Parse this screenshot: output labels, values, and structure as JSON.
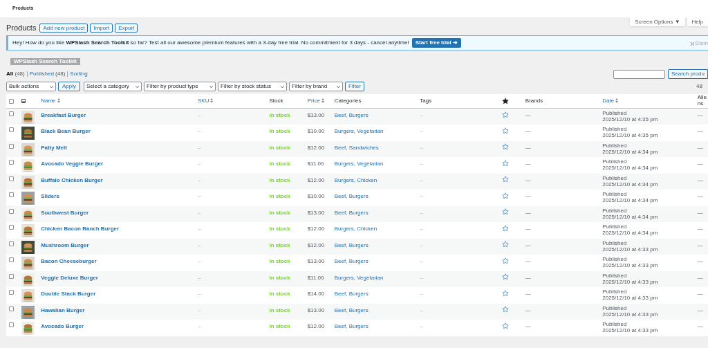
{
  "topbar": {
    "title": "Products"
  },
  "screen_tabs": [
    "Screen Options ▼",
    "Help"
  ],
  "heading": {
    "title": "Products",
    "buttons": [
      "Add new product",
      "Import",
      "Export"
    ]
  },
  "notice": {
    "text": "Hey! How do you like **WPSlash Search Toolkit** so far? Test all our awesome premium features with a 3-day free trial. No commitment for 3 days - cancel anytime!",
    "button": "Start free trial ➜",
    "dismiss": "Dism",
    "badge": "WPSlash Search Toolkit"
  },
  "views": [
    {
      "label": "All",
      "count": "(48)",
      "selected": true
    },
    {
      "label": "Published",
      "count": "(48)",
      "selected": false
    },
    {
      "label": "Sorting",
      "selected": false
    }
  ],
  "search": {
    "button": "Search produ"
  },
  "toolbar": {
    "selects": [
      "Bulk actions",
      "Select a category",
      "Filter by product type",
      "Filter by stock status",
      "Filter by brand"
    ],
    "apply": "Apply",
    "filter": "Filter",
    "count": "48"
  },
  "select_all": {
    "checked": false
  },
  "columns": [
    {
      "kind": "check"
    },
    {
      "kind": "thumb"
    },
    {
      "kind": "text",
      "label": "Name",
      "sortable": true
    },
    {
      "kind": "text",
      "label": "SKU",
      "sortable": true
    },
    {
      "kind": "text",
      "label": "Stock",
      "sortable": false
    },
    {
      "kind": "text",
      "label": "Price",
      "sortable": true
    },
    {
      "kind": "text",
      "label": "Categories",
      "sortable": false
    },
    {
      "kind": "text",
      "label": "Tags",
      "sortable": false
    },
    {
      "kind": "featured"
    },
    {
      "kind": "text",
      "label": "Brands",
      "sortable": false
    },
    {
      "kind": "text",
      "label": "Date",
      "sortable": true
    },
    {
      "kind": "text",
      "label": "Alle ns",
      "sortable": false
    }
  ],
  "rows": [
    {
      "checked": false,
      "name": "Breakfast Burger",
      "sku": "–",
      "stock": "In stock",
      "price": "$13.00",
      "categories": "Beef, Burgers",
      "tags": "–",
      "featured": false,
      "brands": "—",
      "status": "Published",
      "date": "2025/12/10 at 4:35 pm",
      "allergens": "—"
    },
    {
      "checked": false,
      "name": "Black Bean Burger",
      "sku": "–",
      "stock": "In stock",
      "price": "$10.00",
      "categories": "Burgers, Vegetarian",
      "tags": "–",
      "featured": false,
      "brands": "—",
      "status": "Published",
      "date": "2025/12/10 at 4:35 pm",
      "allergens": "—"
    },
    {
      "checked": false,
      "name": "Patty Melt",
      "sku": "–",
      "stock": "In stock",
      "price": "$12.00",
      "categories": "Beef, Sandwiches",
      "tags": "–",
      "featured": false,
      "brands": "—",
      "status": "Published",
      "date": "2025/12/10 at 4:34 pm",
      "allergens": "—"
    },
    {
      "checked": false,
      "name": "Avocado Veggie Burger",
      "sku": "–",
      "stock": "In stock",
      "price": "$11.00",
      "categories": "Burgers, Vegetarian",
      "tags": "–",
      "featured": false,
      "brands": "—",
      "status": "Published",
      "date": "2025/12/10 at 4:34 pm",
      "allergens": "—"
    },
    {
      "checked": false,
      "name": "Buffalo Chicken Burger",
      "sku": "–",
      "stock": "In stock",
      "price": "$12.00",
      "categories": "Burgers, Chicken",
      "tags": "–",
      "featured": false,
      "brands": "—",
      "status": "Published",
      "date": "2025/12/10 at 4:34 pm",
      "allergens": "—"
    },
    {
      "checked": false,
      "name": "Sliders",
      "sku": "–",
      "stock": "In stock",
      "price": "$10.00",
      "categories": "Beef, Burgers",
      "tags": "–",
      "featured": false,
      "brands": "—",
      "status": "Published",
      "date": "2025/12/10 at 4:34 pm",
      "allergens": "—"
    },
    {
      "checked": false,
      "name": "Southwest Burger",
      "sku": "–",
      "stock": "In stock",
      "price": "$13.00",
      "categories": "Beef, Burgers",
      "tags": "–",
      "featured": false,
      "brands": "—",
      "status": "Published",
      "date": "2025/12/10 at 4:34 pm",
      "allergens": "—"
    },
    {
      "checked": false,
      "name": "Chicken Bacon Ranch Burger",
      "sku": "–",
      "stock": "In stock",
      "price": "$12.00",
      "categories": "Burgers, Chicken",
      "tags": "–",
      "featured": false,
      "brands": "—",
      "status": "Published",
      "date": "2025/12/10 at 4:34 pm",
      "allergens": "—"
    },
    {
      "checked": false,
      "name": "Mushroom Burger",
      "sku": "–",
      "stock": "In stock",
      "price": "$12.00",
      "categories": "Beef, Burgers",
      "tags": "–",
      "featured": false,
      "brands": "—",
      "status": "Published",
      "date": "2025/12/10 at 4:33 pm",
      "allergens": "—"
    },
    {
      "checked": false,
      "name": "Bacon Cheeseburger",
      "sku": "–",
      "stock": "In stock",
      "price": "$13.00",
      "categories": "Beef, Burgers",
      "tags": "–",
      "featured": false,
      "brands": "—",
      "status": "Published",
      "date": "2025/12/10 at 4:33 pm",
      "allergens": "—"
    },
    {
      "checked": false,
      "name": "Veggie Deluxe Burger",
      "sku": "–",
      "stock": "In stock",
      "price": "$11.00",
      "categories": "Burgers, Vegetarian",
      "tags": "–",
      "featured": false,
      "brands": "—",
      "status": "Published",
      "date": "2025/12/10 at 4:33 pm",
      "allergens": "—"
    },
    {
      "checked": false,
      "name": "Double Stack Burger",
      "sku": "–",
      "stock": "In stock",
      "price": "$14.00",
      "categories": "Beef, Burgers",
      "tags": "–",
      "featured": false,
      "brands": "—",
      "status": "Published",
      "date": "2025/12/10 at 4:33 pm",
      "allergens": "—"
    },
    {
      "checked": false,
      "name": "Hawaiian Burger",
      "sku": "–",
      "stock": "In stock",
      "price": "$13.00",
      "categories": "Beef, Burgers",
      "tags": "–",
      "featured": false,
      "brands": "—",
      "status": "Published",
      "date": "2025/12/10 at 4:33 pm",
      "allergens": "—"
    },
    {
      "checked": false,
      "name": "Avocado Burger",
      "sku": "–",
      "stock": "In stock",
      "price": "$12.00",
      "categories": "Beef, Burgers",
      "tags": "–",
      "featured": false,
      "brands": "—",
      "status": "Published",
      "date": "2025/12/10 at 4:33 pm",
      "allergens": "—"
    }
  ]
}
